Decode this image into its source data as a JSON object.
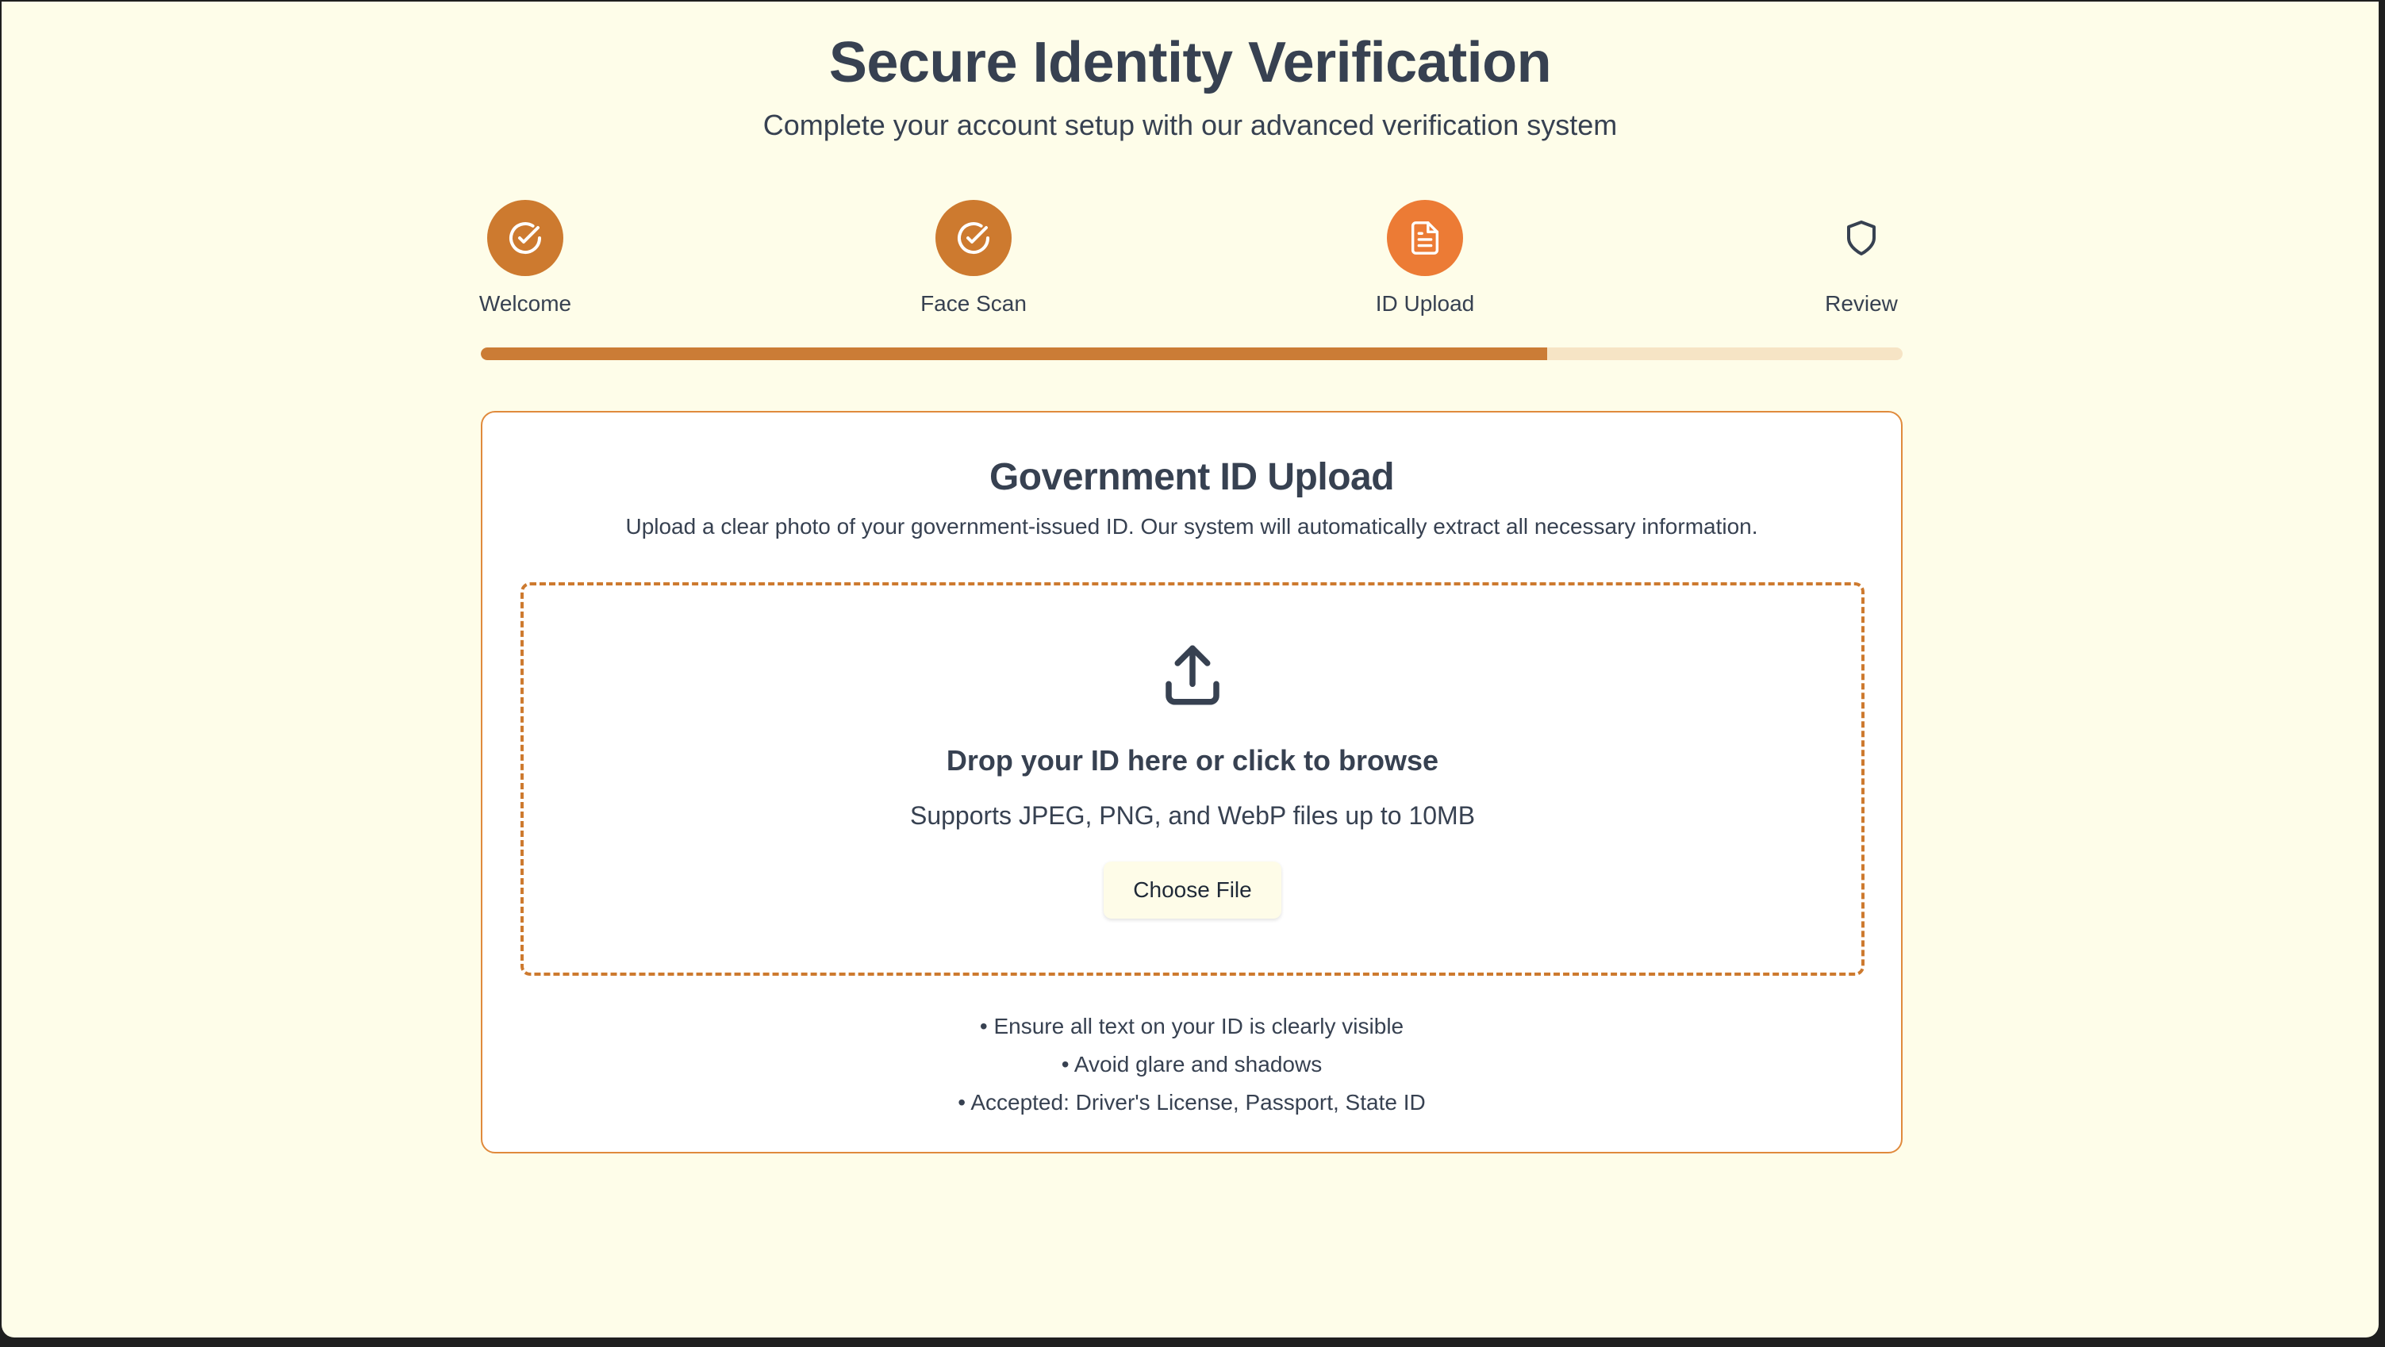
{
  "page": {
    "title": "Secure Identity Verification",
    "subtitle": "Complete your account setup with our advanced verification system"
  },
  "steps": [
    {
      "label": "Welcome",
      "status": "done",
      "icon": "check-circle-icon"
    },
    {
      "label": "Face Scan",
      "status": "done",
      "icon": "check-circle-icon"
    },
    {
      "label": "ID Upload",
      "status": "active",
      "icon": "document-icon"
    },
    {
      "label": "Review",
      "status": "pending",
      "icon": "shield-icon"
    }
  ],
  "progress": {
    "percent": 75
  },
  "card": {
    "title": "Government ID Upload",
    "description": "Upload a clear photo of your government-issued ID. Our system will automatically extract all necessary information.",
    "dropzone": {
      "icon": "upload-icon",
      "title": "Drop your ID here or click to browse",
      "subtitle": "Supports JPEG, PNG, and WebP files up to 10MB",
      "button_label": "Choose File"
    },
    "tips": [
      "Ensure all text on your ID is clearly visible",
      "Avoid glare and shadows",
      "Accepted: Driver's License, Passport, State ID"
    ]
  },
  "colors": {
    "background": "#fefde9",
    "accent": "#cd7a2f",
    "active": "#ec7b35",
    "progress_track": "#f6e4c5",
    "text": "#374151"
  }
}
